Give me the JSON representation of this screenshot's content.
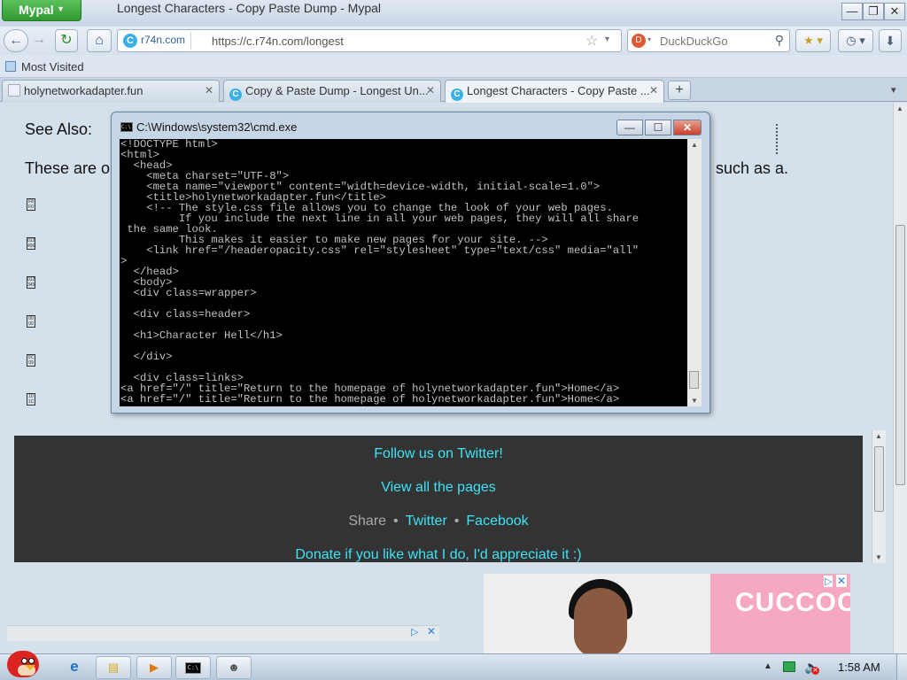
{
  "browser": {
    "app_menu_label": "Mypal",
    "window_title": "Longest Characters - Copy Paste Dump - Mypal",
    "window_controls": {
      "minimize": "—",
      "restore": "❐",
      "close": "✕"
    },
    "nav": {
      "back": "←",
      "forward": "→",
      "reload": "↻",
      "home": "⌂"
    },
    "url": {
      "site_identity": "r74n.com",
      "site_icon": "C",
      "text": "https://c.r74n.com/longest",
      "star": "☆",
      "dropdown": "▾"
    },
    "search": {
      "engine_icon": "D",
      "engine_dropdown": "▾",
      "placeholder": "DuckDuckGo",
      "icon": "⚲"
    },
    "toolbar_buttons": {
      "bookmarks": "★ ▾",
      "history": "◷ ▾",
      "downloads": "⬇"
    },
    "bookmarks_toolbar": {
      "most_visited": "Most Visited"
    },
    "tabs": [
      {
        "label": "holynetworkadapter.fun",
        "icon": "page",
        "close": "✕"
      },
      {
        "label": "Copy & Paste Dump - Longest Un...",
        "icon": "C",
        "close": "✕"
      },
      {
        "label": "Longest Characters - Copy Paste ...",
        "icon": "C",
        "close": "✕",
        "active": true
      }
    ],
    "new_tab": "+",
    "tabs_scroll": "▾"
  },
  "page": {
    "see_also": "See Also:",
    "intro_left": "These are o",
    "intro_right": "such as a.",
    "glyph_codes": [
      "F8\nF0",
      "0123\n4568",
      "012\n345",
      "00\n00",
      "0C\n09",
      "10\n1C"
    ],
    "footer": {
      "twitter_link": "Follow us on Twitter!",
      "pages_link": "View all the pages",
      "share_label": "Share",
      "share_sep": "•",
      "share_twitter": "Twitter",
      "share_facebook": "Facebook",
      "donate_link": "Donate if you like what I do, I'd appreciate it :)"
    },
    "ad": {
      "brand": "CUCCOO",
      "info_icon": "▷",
      "close_icon": "✕"
    }
  },
  "cmd_window": {
    "title": "C:\\Windows\\system32\\cmd.exe",
    "icon_text": "C:\\",
    "controls": {
      "minimize": "—",
      "maximize": "☐",
      "close": "✕"
    },
    "lines": [
      "<!DOCTYPE html>",
      "<html>",
      "  <head>",
      "    <meta charset=\"UTF-8\">",
      "    <meta name=\"viewport\" content=\"width=device-width, initial-scale=1.0\">",
      "    <title>holynetworkadapter.fun</title>",
      "    <!-- The style.css file allows you to change the look of your web pages.",
      "         If you include the next line in all your web pages, they will all share",
      " the same look.",
      "         This makes it easier to make new pages for your site. -->",
      "    <link href=\"/headeropacity.css\" rel=\"stylesheet\" type=\"text/css\" media=\"all\"",
      ">",
      "  </head>",
      "  <body>",
      "  <div class=wrapper>",
      "",
      "  <div class=header>",
      "",
      "  <h1>Character Hell</h1>",
      "",
      "  </div>",
      "",
      "  <div class=links>",
      "<a href=\"/\" title=\"Return to the homepage of holynetworkadapter.fun\">Home</a>",
      "<a href=\"/\" title=\"Return to the homepage of holynetworkadapter.fun\">Home</a>"
    ]
  },
  "taskbar": {
    "ie_icon": "e",
    "explorer_icon": "▤",
    "media_icon": "▶",
    "cmd_icon": "C:\\",
    "app_icon": "☻",
    "tray_up": "▲",
    "volume_icon": "🔈",
    "volume_muted": "✕",
    "clock": "1:58 AM"
  }
}
